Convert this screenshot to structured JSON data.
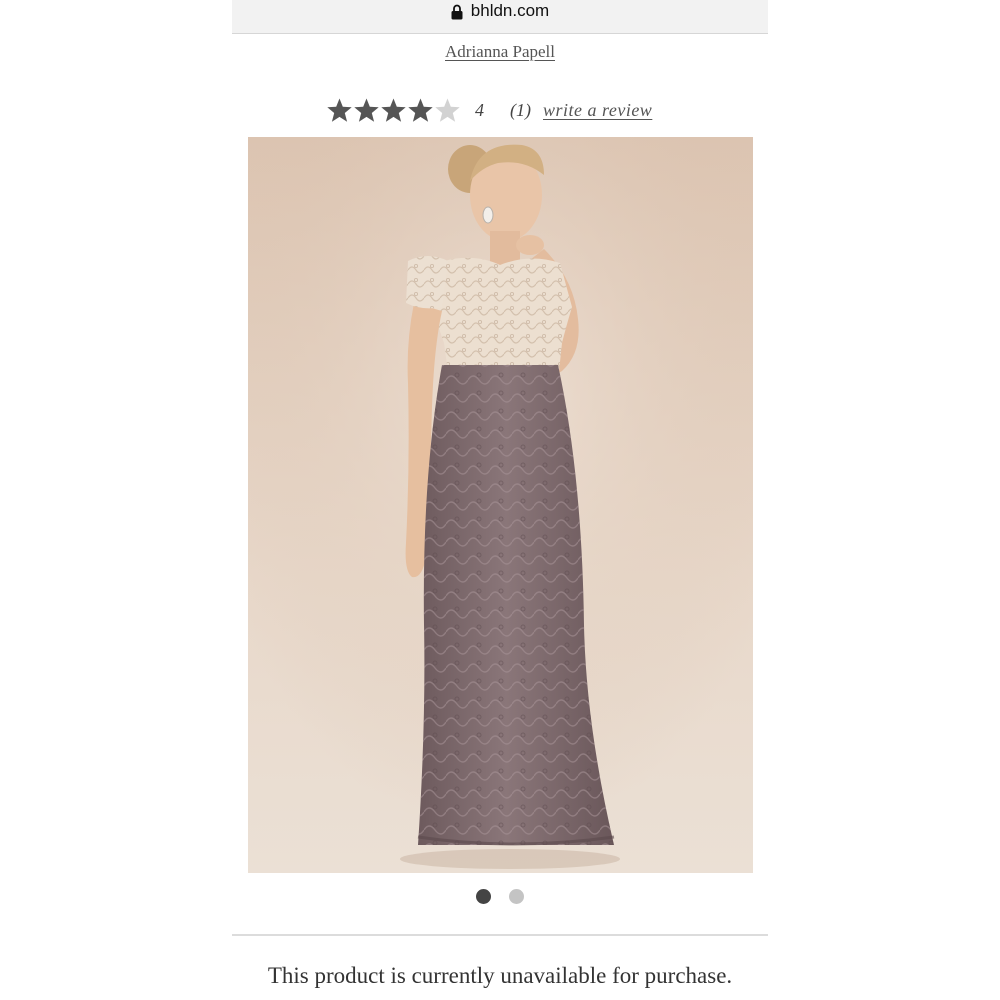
{
  "browser": {
    "url": "bhldn.com",
    "lock_icon": "lock-icon"
  },
  "product": {
    "brand": "Adrianna Papell",
    "rating": {
      "value": 4,
      "value_label": "4",
      "max": 5,
      "review_count_label": "(1)",
      "write_review_label": "write a review"
    },
    "image_alt": "",
    "carousel": {
      "total": 2,
      "active_index": 0
    },
    "availability_message": "This product is currently unavailable for purchase."
  },
  "colors": {
    "star_filled": "#555555",
    "star_empty": "#d2d2d2",
    "dot_active": "#444444",
    "dot_inactive": "#c4c4c4",
    "photo_background": "#e4d3c4",
    "dress_top": "#ece0d2",
    "dress_skirt": "#7e6a6c"
  }
}
